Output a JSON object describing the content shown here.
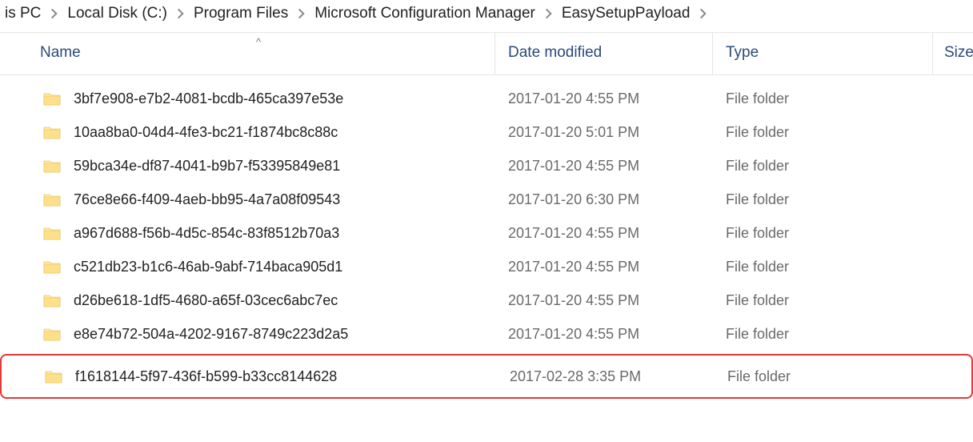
{
  "breadcrumb": [
    "is PC",
    "Local Disk (C:)",
    "Program Files",
    "Microsoft Configuration Manager",
    "EasySetupPayload"
  ],
  "columns": {
    "name": "Name",
    "date": "Date modified",
    "type": "Type",
    "size": "Size"
  },
  "sort_indicator": "^",
  "items": [
    {
      "name": "3bf7e908-e7b2-4081-bcdb-465ca397e53e",
      "date": "2017-01-20 4:55 PM",
      "type": "File folder",
      "highlight": false
    },
    {
      "name": "10aa8ba0-04d4-4fe3-bc21-f1874bc8c88c",
      "date": "2017-01-20 5:01 PM",
      "type": "File folder",
      "highlight": false
    },
    {
      "name": "59bca34e-df87-4041-b9b7-f53395849e81",
      "date": "2017-01-20 4:55 PM",
      "type": "File folder",
      "highlight": false
    },
    {
      "name": "76ce8e66-f409-4aeb-bb95-4a7a08f09543",
      "date": "2017-01-20 6:30 PM",
      "type": "File folder",
      "highlight": false
    },
    {
      "name": "a967d688-f56b-4d5c-854c-83f8512b70a3",
      "date": "2017-01-20 4:55 PM",
      "type": "File folder",
      "highlight": false
    },
    {
      "name": "c521db23-b1c6-46ab-9abf-714baca905d1",
      "date": "2017-01-20 4:55 PM",
      "type": "File folder",
      "highlight": false
    },
    {
      "name": "d26be618-1df5-4680-a65f-03cec6abc7ec",
      "date": "2017-01-20 4:55 PM",
      "type": "File folder",
      "highlight": false
    },
    {
      "name": "e8e74b72-504a-4202-9167-8749c223d2a5",
      "date": "2017-01-20 4:55 PM",
      "type": "File folder",
      "highlight": false
    },
    {
      "name": "f1618144-5f97-436f-b599-b33cc8144628",
      "date": "2017-02-28 3:35 PM",
      "type": "File folder",
      "highlight": true
    }
  ]
}
